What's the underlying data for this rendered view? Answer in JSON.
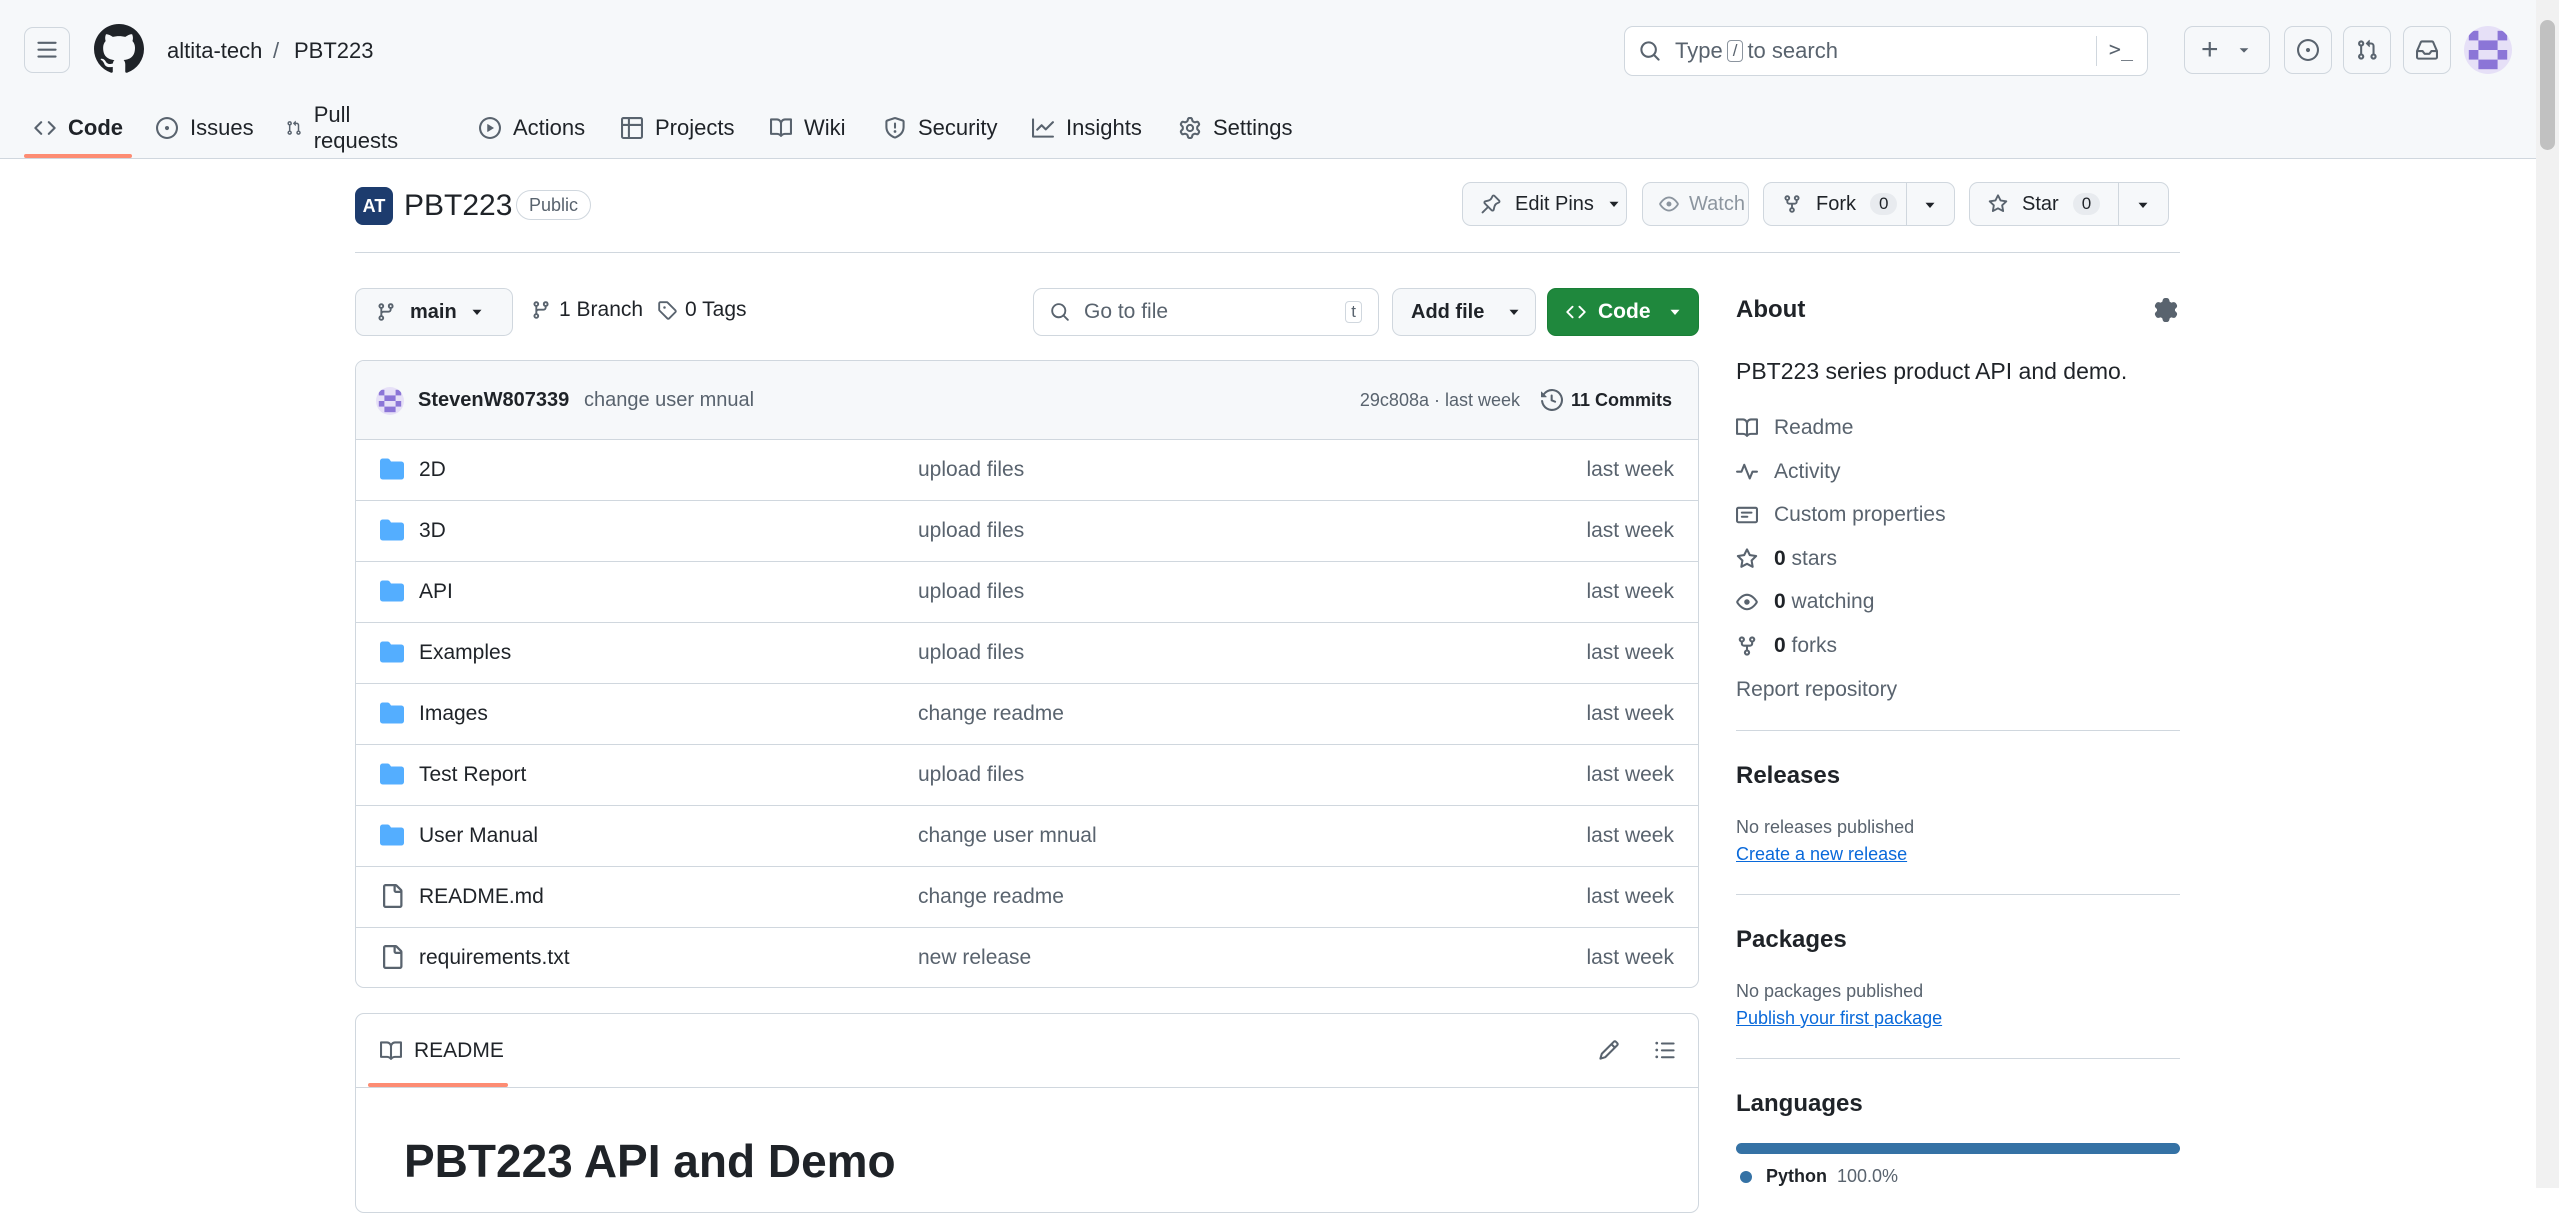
{
  "header": {
    "owner": "altita-tech",
    "separator": "/",
    "repo": "PBT223",
    "search_placeholder_prefix": "Type",
    "search_key": "/",
    "search_placeholder_suffix": "to search",
    "plus": "+",
    "prompt_glyph": ">_"
  },
  "tabs": [
    {
      "label": "Code"
    },
    {
      "label": "Issues"
    },
    {
      "label": "Pull requests"
    },
    {
      "label": "Actions"
    },
    {
      "label": "Projects"
    },
    {
      "label": "Wiki"
    },
    {
      "label": "Security"
    },
    {
      "label": "Insights"
    },
    {
      "label": "Settings"
    }
  ],
  "repo": {
    "logo_text": "AT",
    "name": "PBT223",
    "visibility": "Public",
    "edit_pins": "Edit Pins",
    "watch": "Watch",
    "fork": "Fork",
    "fork_count": "0",
    "star": "Star",
    "star_count": "0"
  },
  "toolbar": {
    "branch": "main",
    "branches": "1 Branch",
    "tags": "0 Tags",
    "go_to_file": "Go to file",
    "go_key": "t",
    "add_file": "Add file",
    "code": "Code"
  },
  "commit": {
    "author": "StevenW807339",
    "message": "change user mnual",
    "sha_time": "29c808a · last week",
    "commits": "11 Commits"
  },
  "files": [
    {
      "name": "2D",
      "type": "folder",
      "message": "upload files",
      "time": "last week"
    },
    {
      "name": "3D",
      "type": "folder",
      "message": "upload files",
      "time": "last week"
    },
    {
      "name": "API",
      "type": "folder",
      "message": "upload files",
      "time": "last week"
    },
    {
      "name": "Examples",
      "type": "folder",
      "message": "upload files",
      "time": "last week"
    },
    {
      "name": "Images",
      "type": "folder",
      "message": "change readme",
      "time": "last week"
    },
    {
      "name": "Test Report",
      "type": "folder",
      "message": "upload files",
      "time": "last week"
    },
    {
      "name": "User Manual",
      "type": "folder",
      "message": "change user mnual",
      "time": "last week"
    },
    {
      "name": "README.md",
      "type": "file",
      "message": "change readme",
      "time": "last week"
    },
    {
      "name": "requirements.txt",
      "type": "file",
      "message": "new release",
      "time": "last week"
    }
  ],
  "readme": {
    "tab": "README",
    "heading": "PBT223 API and Demo"
  },
  "about": {
    "title": "About",
    "description": "PBT223 series product API and demo.",
    "readme": "Readme",
    "activity": "Activity",
    "custom_properties": "Custom properties",
    "stars_num": "0",
    "stars_label": "stars",
    "watching_num": "0",
    "watching_label": "watching",
    "forks_num": "0",
    "forks_label": "forks",
    "report": "Report repository"
  },
  "releases": {
    "title": "Releases",
    "none": "No releases published",
    "create": "Create a new release"
  },
  "packages": {
    "title": "Packages",
    "none": "No packages published",
    "publish": "Publish your first package"
  },
  "languages": {
    "title": "Languages",
    "items": [
      {
        "name": "Python",
        "percent_label": "100.0%",
        "share": 1.0,
        "color": "#3572A5"
      }
    ]
  },
  "colors": {
    "accent_green": "#1f883d",
    "link_blue": "#0969da",
    "folder_blue": "#54aeff",
    "tab_underline": "#fd8c73"
  }
}
